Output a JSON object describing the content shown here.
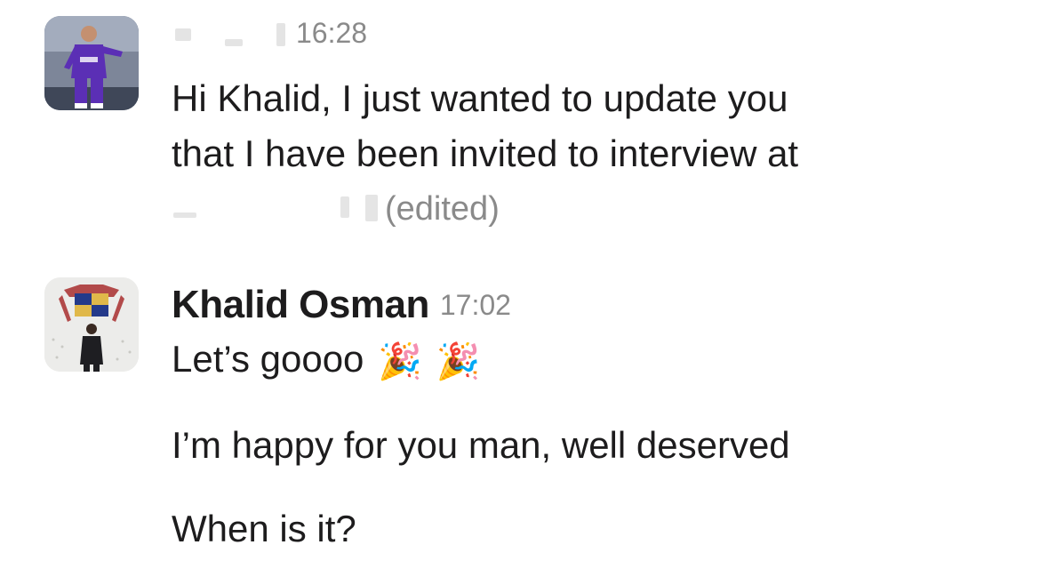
{
  "messages": [
    {
      "time": "16:28",
      "text_lines": [
        "Hi Khalid, I just wanted to update you",
        "that I have been invited to interview at"
      ],
      "edited_label": "(edited)"
    },
    {
      "sender": "Khalid Osman",
      "time": "17:02",
      "paragraphs": [
        "Let’s goooo",
        "I’m happy for you man, well deserved",
        "When is it?"
      ],
      "emoji": [
        "party-popper",
        "party-popper"
      ]
    }
  ],
  "colors": {
    "text": "#1d1c1d",
    "meta": "#8a8a8a",
    "jersey": "#5b2fb5"
  },
  "icons": {
    "party_glyph": "🎉"
  }
}
